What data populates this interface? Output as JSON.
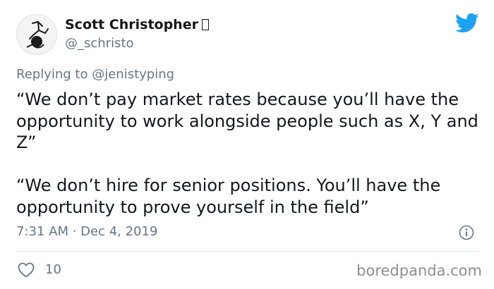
{
  "tweet": {
    "author": {
      "display_name": "Scott Christopher",
      "name_suffix_glyph": "□",
      "handle": "@_schristo"
    },
    "replying_prefix": "Replying to ",
    "replying_to": "@jenistyping",
    "paragraphs": [
      "“We don’t pay market rates because you’ll have the opportunity to work alongside people such as X, Y and Z”",
      "“We don’t hire for senior positions. You’ll have the opportunity to prove yourself in the field”"
    ],
    "timestamp": "7:31 AM · Dec 4, 2019",
    "like_count": "10"
  },
  "icons": {
    "platform_logo": "twitter-bird-icon",
    "avatar": "avatar",
    "info": "info-icon",
    "like": "heart-icon"
  },
  "watermark": "boredpanda.com",
  "colors": {
    "brand": "#1da1f2",
    "text": "#14171a",
    "secondary": "#657786",
    "divider": "#e1e8ed"
  }
}
